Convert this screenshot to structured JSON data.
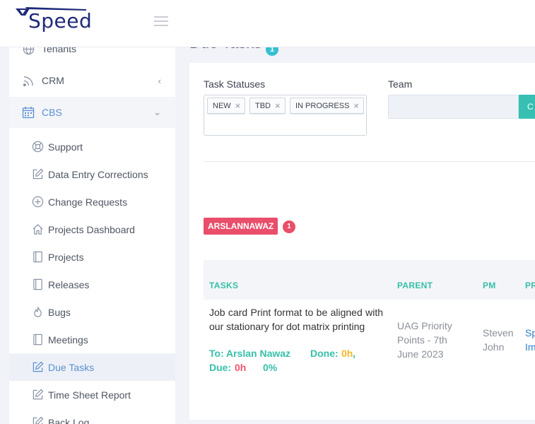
{
  "app": {
    "logo_text": "Speed"
  },
  "sidebar": {
    "items": [
      {
        "label": "Tenants",
        "icon": "globe-icon"
      },
      {
        "label": "CRM",
        "icon": "rss-icon",
        "chevron": "‹"
      },
      {
        "label": "CBS",
        "icon": "calendar-icon",
        "chevron": "⌄"
      }
    ],
    "sub_items": [
      {
        "label": "Support",
        "icon": "lifebuoy-icon"
      },
      {
        "label": "Data Entry Corrections",
        "icon": "edit-icon"
      },
      {
        "label": "Change Requests",
        "icon": "plus-circle-icon"
      },
      {
        "label": "Projects Dashboard",
        "icon": "home-icon"
      },
      {
        "label": "Projects",
        "icon": "book-icon"
      },
      {
        "label": "Releases",
        "icon": "book-icon"
      },
      {
        "label": "Bugs",
        "icon": "fire-icon"
      },
      {
        "label": "Meetings",
        "icon": "book-icon"
      },
      {
        "label": "Due Tasks",
        "icon": "edit-icon"
      },
      {
        "label": "Time Sheet Report",
        "icon": "edit-icon"
      },
      {
        "label": "Back Log",
        "icon": "edit-icon"
      }
    ]
  },
  "page": {
    "title": "Due Tasks",
    "count": "1"
  },
  "filters": {
    "statuses_label": "Task Statuses",
    "statuses": [
      "NEW",
      "TBD",
      "IN PROGRESS"
    ],
    "team_label": "Team",
    "team_button": "C"
  },
  "group": {
    "user": "ARSLANNAWAZ",
    "count": "1"
  },
  "table": {
    "headers": [
      "TASKS",
      "PARENT",
      "PM",
      "PR"
    ],
    "row": {
      "description": "Job card Print format to be aligned with our stationary for dot matrix printing",
      "to_label": "To:",
      "to_value": "Arslan Nawaz",
      "done_label": "Done:",
      "done_value": "0h",
      "done_sep": ",",
      "due_label": "Due:",
      "due_value": "0h",
      "percent": "0%",
      "parent": "UAG Priority Points - 7th June 2023",
      "pm": "Steven John",
      "project": "Sp Im"
    }
  },
  "colors": {
    "accent": "#36bfa9",
    "danger": "#e94e6a",
    "warning": "#f2b82b",
    "brand": "#1f2a7a"
  }
}
